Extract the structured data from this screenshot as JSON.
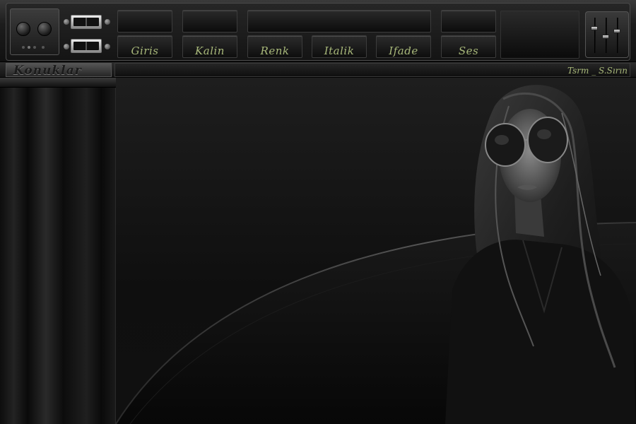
{
  "menu": {
    "items": [
      {
        "label": "Giris"
      },
      {
        "label": "Kalin"
      },
      {
        "label": "Renk"
      },
      {
        "label": "Italik"
      },
      {
        "label": "Ifade"
      },
      {
        "label": "Ses"
      }
    ]
  },
  "sidebar": {
    "title": "Konuklar"
  },
  "status": {
    "text": "Tsrm _ S.Sırın"
  },
  "colors": {
    "label_text": "#a8b87a",
    "background": "#0a0a0a"
  },
  "icons": [
    "knob-icon",
    "toggle-switch-icon",
    "mixer-fader-icon"
  ]
}
